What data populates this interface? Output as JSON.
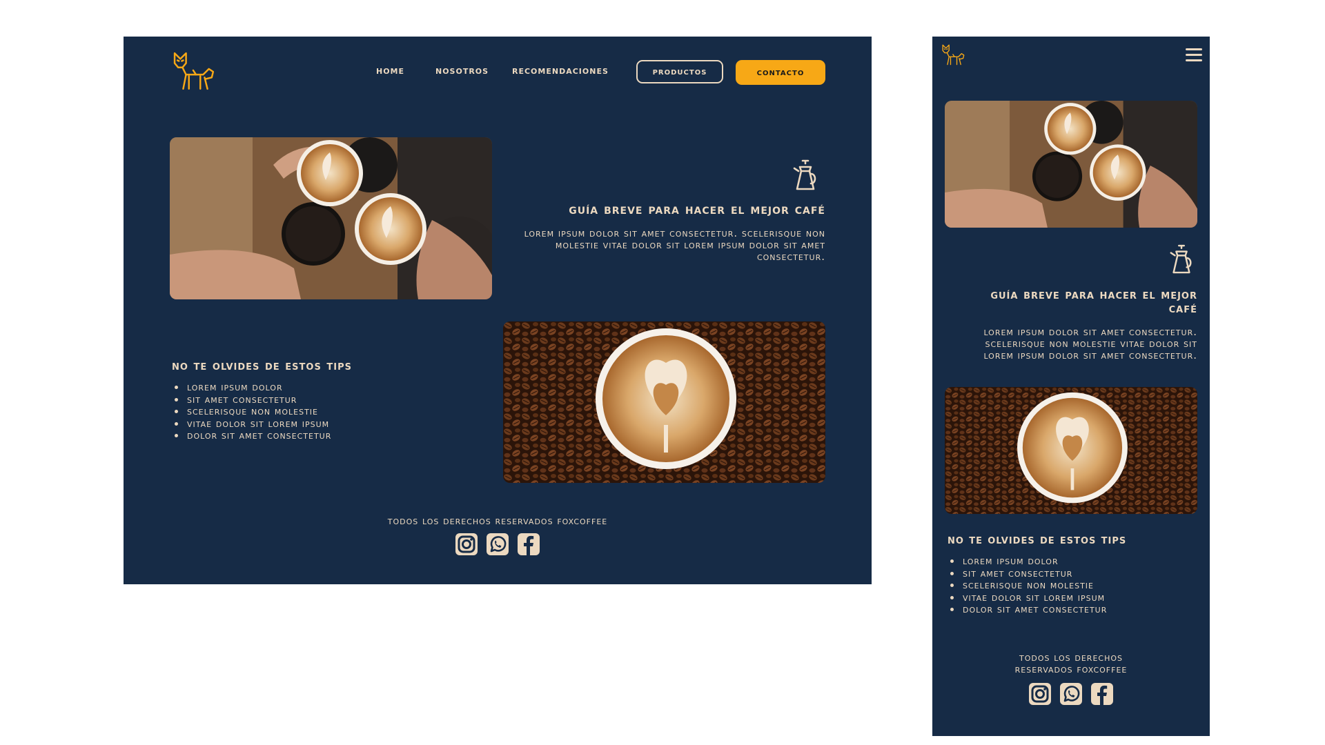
{
  "brand": {
    "logo_icon": "fox-logo-icon",
    "logo_color": "#f7a816"
  },
  "colors": {
    "background": "#162b46",
    "text": "#ecd9c0",
    "accent": "#f7a816"
  },
  "nav": {
    "home": "home",
    "nosotros": "nosotros",
    "recomendaciones": "recomendaciones",
    "productos": "productos",
    "contacto": "contacto"
  },
  "guide": {
    "icon": "coffee-pot-icon",
    "title": "Guía breve para hacer el mejor café",
    "text": "Lorem ipsum dolor sit amet consectetur. Scelerisque non molestie vitae dolor sit Lorem ipsum dolor sit amet consectetur."
  },
  "tips": {
    "title": "No te olvides de estos tips",
    "items": [
      "Lorem ipsum dolor",
      "sit amet consectetur",
      "Scelerisque non molestie",
      " vitae dolor sit Lorem ipsum",
      "dolor sit amet consectetur"
    ]
  },
  "images": {
    "cheers": "coffee-cups-cheers-photo",
    "latte": "latte-art-on-beans-photo"
  },
  "footer": {
    "text": "Todos los derechos reservados FoxCoffee",
    "social_icons": [
      "instagram-icon",
      "whatsapp-icon",
      "facebook-icon"
    ]
  },
  "mobile": {
    "menu_icon": "hamburger-menu-icon"
  }
}
